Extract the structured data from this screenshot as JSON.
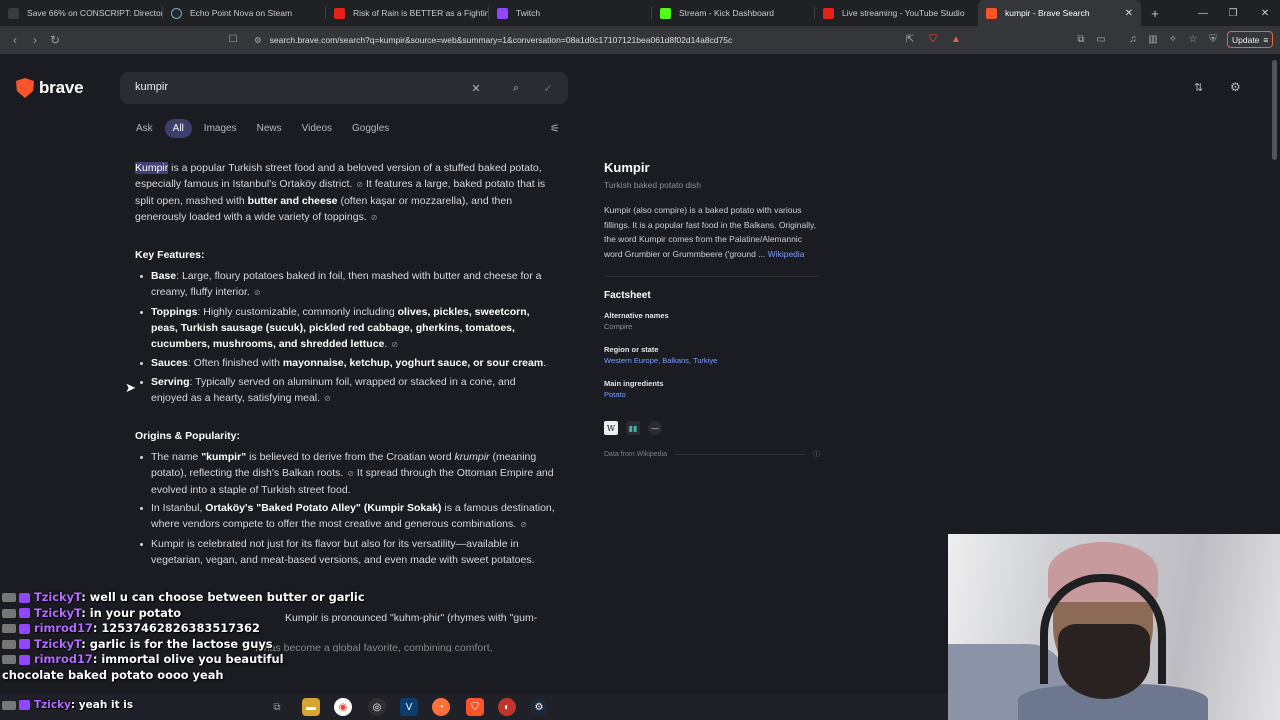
{
  "browser": {
    "tabs": [
      {
        "label": "Save 66% on CONSCRIPT: Director's",
        "color": "#3a3b41"
      },
      {
        "label": "Echo Point Nova on Steam",
        "color": "#1b2838"
      },
      {
        "label": "Risk of Rain is BETTER as a Fighting",
        "color": "#e62117"
      },
      {
        "label": "Twitch",
        "color": "#9146ff"
      },
      {
        "label": "Stream - Kick Dashboard",
        "color": "#53fc18"
      },
      {
        "label": "Live streaming - YouTube Studio",
        "color": "#e62117"
      },
      {
        "label": "kumpir - Brave Search",
        "color": "#fb542b"
      }
    ],
    "new_tab": "+",
    "url": "search.brave.com/search?q=kumpir&source=web&summary=1&conversation=08a1d0c17107121bea061d8f02d14a8cd75c",
    "update_label": "Update"
  },
  "search": {
    "brand": "brave",
    "query": "kumpir",
    "tabs": [
      "Ask",
      "All",
      "Images",
      "News",
      "Videos",
      "Goggles"
    ],
    "active_tab": "All"
  },
  "answer": {
    "intro_term": "Kumpir",
    "intro_a": " is a popular Turkish street food and a beloved version of a stuffed baked potato, especially famous in Istanbul's Ortaköy district.",
    "intro_b": " It features a large, baked potato that is split open, mashed with ",
    "intro_bold": "butter and cheese",
    "intro_c": " (often kaşar or mozzarella), and then generously loaded with a wide variety of toppings.",
    "key_features_heading": "Key Features:",
    "features": [
      {
        "label": "Base",
        "text": ": Large, floury potatoes baked in foil, then mashed with butter and cheese for a creamy, fluffy interior."
      },
      {
        "label": "Toppings",
        "text": ": Highly customizable, commonly including ",
        "bold": "olives, pickles, sweetcorn, peas, Turkish sausage (sucuk), pickled red cabbage, gherkins, tomatoes, cucumbers, mushrooms, and shredded lettuce",
        "tail": "."
      },
      {
        "label": "Sauces",
        "text": ": Often finished with ",
        "bold": "mayonnaise, ketchup, yoghurt sauce, or sour cream",
        "tail": "."
      },
      {
        "label": "Serving",
        "text": ": Typically served on aluminum foil, wrapped or stacked in a cone, and enjoyed as a hearty, satisfying meal."
      }
    ],
    "origins_heading": "Origins & Popularity:",
    "origins": [
      {
        "a": "The name ",
        "b1": "\"kumpir\"",
        "c": " is believed to derive from the Croatian word ",
        "i": "krumpir",
        "d": " (meaning potato), reflecting the dish's Balkan roots.",
        "e": " It spread through the Ottoman Empire and evolved into a staple of Turkish street food."
      },
      {
        "a": "In Istanbul, ",
        "b1": "Ortaköy's \"Baked Potato Alley\" (Kumpir Sokak)",
        "c": " is a famous destination, where vendors compete to offer the most creative and generous combinations."
      },
      {
        "a": "Kumpir is celebrated not just for its flavor but also for its versatility—available in vegetarian, vegan, and meat-based versions, and even made with sweet potatoes."
      }
    ],
    "partial_line_1": "Kumpir is pronounced \"kuhm-phir\" (rhymes with \"gum-fer\").",
    "partial_line_2": "It has become a global favorite, combining comfort, customization, and"
  },
  "infobox": {
    "title": "Kumpir",
    "subtitle": "Turkish baked potato dish",
    "description": "Kumpir (also compire) is a baked potato with various fillings. It is a popular fast food in the Balkans. Originally, the word Kumpir comes from the Palatine/Alemannic word Grumbier or Grummbeere ('ground ...",
    "description_link": "Wikipedia",
    "factsheet_heading": "Factsheet",
    "facts": [
      {
        "key": "Alternative names",
        "value": "Compire",
        "link": false
      },
      {
        "key": "Region or state",
        "value": "Western Europe, Balkans, Turkiye",
        "link": true
      },
      {
        "key": "Main ingredients",
        "value": "Potato",
        "link": true
      }
    ],
    "source_icons": [
      "W",
      "▮▮",
      "—"
    ],
    "footer": "Data from Wikipedia"
  },
  "chat": [
    {
      "user": "TzickyT",
      "msg": "well u can choose between butter or garlic"
    },
    {
      "user": "TzickyT",
      "msg": "in your potato"
    },
    {
      "user": "rimrod17",
      "msg": "12537462826383517362"
    },
    {
      "user": "TzickyT",
      "msg": "garlic is for the lactose guys"
    },
    {
      "user": "rimrod17",
      "msg": "immortal olive you beautiful chocolate baked potato oooo yeah"
    },
    {
      "user": "Tzicky",
      "msg": "yeah it is"
    }
  ]
}
